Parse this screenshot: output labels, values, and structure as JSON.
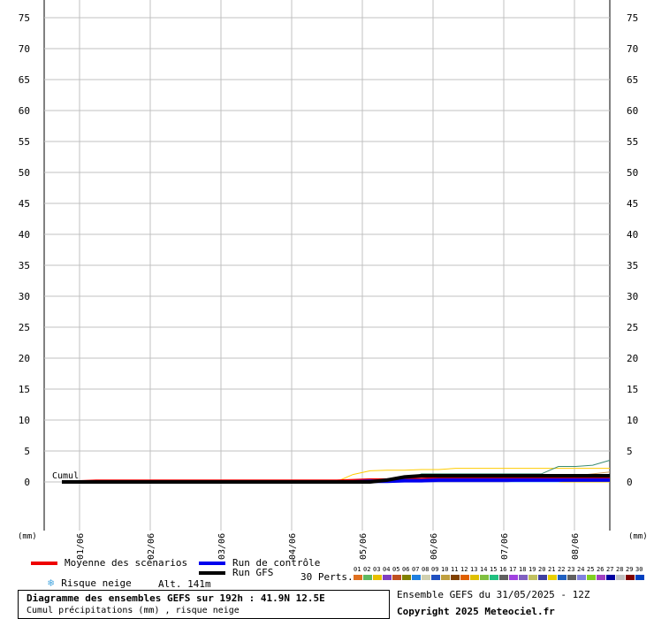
{
  "chart_data": {
    "type": "line",
    "y_ticks": [
      0,
      5,
      10,
      15,
      20,
      25,
      30,
      35,
      40,
      45,
      50,
      55,
      60,
      65,
      70,
      75
    ],
    "ylim": [
      0,
      78
    ],
    "x_tick_labels": [
      "01/06",
      "02/06",
      "03/06",
      "04/06",
      "05/06",
      "06/06",
      "07/06",
      "08/06"
    ],
    "unit_left": "(mm)",
    "unit_right": "(mm)",
    "cumul_label": "Cumul",
    "x_hours": [
      0,
      6,
      12,
      18,
      24,
      30,
      36,
      42,
      48,
      54,
      60,
      66,
      72,
      78,
      84,
      90,
      96,
      102,
      108,
      114,
      120,
      126,
      132,
      138,
      144,
      150,
      156,
      162,
      168,
      174,
      180,
      186,
      192
    ],
    "series": [
      {
        "name": "Moyenne des scénarios",
        "color": "#ee0000",
        "width": 4,
        "values": [
          0,
          0,
          0.1,
          0.1,
          0.1,
          0.1,
          0.1,
          0.1,
          0.1,
          0.1,
          0.1,
          0.1,
          0.1,
          0.1,
          0.1,
          0.1,
          0.1,
          0.2,
          0.3,
          0.3,
          0.4,
          0.4,
          0.5,
          0.5,
          0.5,
          0.6,
          0.6,
          0.6,
          0.7,
          0.7,
          0.7,
          0.8,
          0.8
        ]
      },
      {
        "name": "Run de contrôle",
        "color": "#0000ee",
        "width": 4,
        "values": [
          0,
          0,
          0,
          0,
          0,
          0,
          0,
          0,
          0,
          0,
          0,
          0,
          0,
          0,
          0,
          0,
          0,
          0,
          0.1,
          0.1,
          0.2,
          0.2,
          0.3,
          0.3,
          0.3,
          0.3,
          0.3,
          0.3,
          0.3,
          0.3,
          0.3,
          0.3,
          0.3
        ]
      },
      {
        "name": "Run GFS",
        "color": "#000000",
        "width": 4,
        "values": [
          0,
          0,
          0,
          0,
          0,
          0,
          0,
          0,
          0,
          0,
          0,
          0,
          0,
          0,
          0,
          0,
          0,
          0,
          0,
          0.3,
          0.8,
          1.0,
          1.0,
          1.0,
          1.0,
          1.0,
          1.0,
          1.0,
          1.0,
          1.0,
          1.0,
          1.0,
          1.0
        ]
      }
    ],
    "perturbations": [
      {
        "color": "#e8c000",
        "values": [
          0,
          0,
          0,
          0,
          0,
          0,
          0,
          0,
          0,
          0,
          0,
          0,
          0,
          0,
          0,
          0,
          0,
          0,
          0,
          0,
          0,
          0,
          0,
          0,
          0,
          0,
          0,
          0,
          0,
          0,
          0,
          0,
          0
        ]
      },
      {
        "color": "#ffcc00",
        "values": [
          0,
          0,
          0,
          0,
          0,
          0,
          0,
          0,
          0,
          0,
          0,
          0,
          0,
          0,
          0,
          0,
          0,
          1.2,
          1.8,
          1.9,
          1.9,
          2.0,
          2.0,
          2.2,
          2.2,
          2.2,
          2.2,
          2.2,
          2.2,
          2.2,
          2.2,
          2.2,
          2.2
        ]
      },
      {
        "color": "#3c8c70",
        "values": [
          0,
          0,
          0,
          0,
          0,
          0,
          0,
          0,
          0,
          0,
          0,
          0,
          0,
          0,
          0,
          0,
          0,
          0,
          0,
          0,
          0.1,
          1.3,
          1.3,
          1.3,
          1.3,
          1.3,
          1.3,
          1.3,
          1.3,
          2.5,
          2.5,
          2.7,
          3.5,
          3.6,
          3.7,
          3.7
        ]
      },
      {
        "color": "#d4a060",
        "values": [
          0,
          0,
          0,
          0,
          0,
          0,
          0,
          0,
          0,
          0,
          0,
          0,
          0,
          0,
          0,
          0,
          0,
          0,
          0,
          0,
          0,
          0,
          0,
          0,
          0.6,
          0.8,
          0.8,
          0.8,
          0.8,
          0.8,
          1.0,
          1.3,
          1.6
        ]
      },
      {
        "color": "#88c8e8",
        "values": [
          0,
          0,
          0,
          0,
          0,
          0,
          0,
          0,
          0,
          0,
          0,
          0,
          0,
          0,
          0,
          0,
          0,
          0,
          0,
          0,
          0,
          0,
          0,
          0,
          0,
          0,
          0,
          0,
          0,
          0,
          0.5,
          0.8,
          0.8
        ]
      },
      {
        "color": "#60a060",
        "values": [
          0,
          0,
          0,
          0,
          0,
          0,
          0,
          0,
          0,
          0,
          0,
          0,
          0,
          0,
          0,
          0,
          0,
          0,
          0,
          0,
          0,
          0.4,
          0.6,
          0.6,
          0.6,
          0.6,
          0.6,
          1.2,
          1.2,
          1.2,
          1.2,
          1.2,
          1.2
        ]
      },
      {
        "color": "#8080c0",
        "values": [
          0,
          0,
          0,
          0,
          0,
          0,
          0,
          0,
          0,
          0,
          0,
          0,
          0,
          0,
          0,
          0,
          0,
          0,
          0,
          0,
          0,
          0,
          0,
          0,
          0,
          0,
          0,
          0.3,
          0.3,
          0.5,
          0.5,
          0.5,
          0.5
        ]
      },
      {
        "color": "#c08040",
        "values": [
          0,
          0,
          0,
          0,
          0,
          0,
          0,
          0,
          0,
          0,
          0,
          0,
          0,
          0,
          0,
          0,
          0,
          0,
          0,
          0.2,
          0.2,
          0.4,
          0.4,
          0.4,
          0.4,
          0.4,
          0.4,
          0.4,
          0.4,
          0.4,
          0.4,
          0.4,
          0.4
        ]
      }
    ]
  },
  "legend": {
    "moyenne": "Moyenne des scénarios",
    "controle": "Run de contrôle",
    "gfs": "Run GFS",
    "neige": "Risque neige",
    "alt": "Alt. 141m",
    "perts_label": "30 Perts."
  },
  "perts": {
    "numbers": [
      "01",
      "02",
      "03",
      "04",
      "05",
      "06",
      "07",
      "08",
      "09",
      "10",
      "11",
      "12",
      "13",
      "14",
      "15",
      "16",
      "17",
      "18",
      "19",
      "20",
      "21",
      "22",
      "23",
      "24",
      "25",
      "26",
      "27",
      "28",
      "29",
      "30"
    ],
    "colors": [
      "#e07020",
      "#60b860",
      "#e8c000",
      "#8040c0",
      "#c05020",
      "#808000",
      "#2080e0",
      "#d0d0b0",
      "#2050c0",
      "#c0a040",
      "#804000",
      "#e06000",
      "#e0c000",
      "#80c040",
      "#20c080",
      "#606060",
      "#a040e0",
      "#8060c0",
      "#c0c060",
      "#4040a0",
      "#e8d000",
      "#2060c0",
      "#606060",
      "#8080e0",
      "#80d020",
      "#a040c0",
      "#0000a0",
      "#c0c0c0",
      "#800000",
      "#0040c0"
    ]
  },
  "footer": {
    "title": "Diagramme des ensembles GEFS sur 192h : 41.9N 12.5E",
    "subtitle": "Cumul précipitations (mm) , risque neige",
    "run_info": "Ensemble GEFS du 31/05/2025 - 12Z",
    "copyright": "Copyright 2025 Meteociel.fr"
  },
  "colors": {
    "grid": "#c0c0c0",
    "snow_icon": "#4aa8e0"
  },
  "icons": {
    "snow": "snowflake-icon"
  }
}
